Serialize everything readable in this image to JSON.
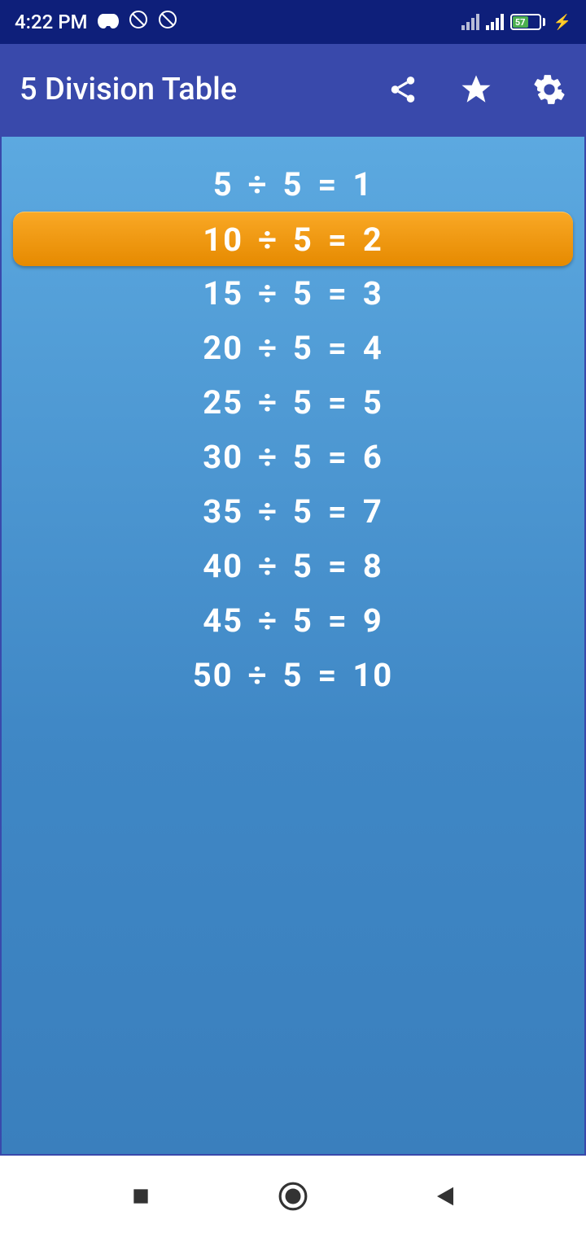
{
  "status": {
    "time": "4:22 PM",
    "battery": "57"
  },
  "header": {
    "title": "5 Division Table"
  },
  "table": {
    "rows": [
      {
        "dividend": "5",
        "divisor": "5",
        "result": "1",
        "highlighted": false
      },
      {
        "dividend": "10",
        "divisor": "5",
        "result": "2",
        "highlighted": true
      },
      {
        "dividend": "15",
        "divisor": "5",
        "result": "3",
        "highlighted": false
      },
      {
        "dividend": "20",
        "divisor": "5",
        "result": "4",
        "highlighted": false
      },
      {
        "dividend": "25",
        "divisor": "5",
        "result": "5",
        "highlighted": false
      },
      {
        "dividend": "30",
        "divisor": "5",
        "result": "6",
        "highlighted": false
      },
      {
        "dividend": "35",
        "divisor": "5",
        "result": "7",
        "highlighted": false
      },
      {
        "dividend": "40",
        "divisor": "5",
        "result": "8",
        "highlighted": false
      },
      {
        "dividend": "45",
        "divisor": "5",
        "result": "9",
        "highlighted": false
      },
      {
        "dividend": "50",
        "divisor": "5",
        "result": "10",
        "highlighted": false
      }
    ],
    "operator": "÷",
    "equals": "="
  }
}
